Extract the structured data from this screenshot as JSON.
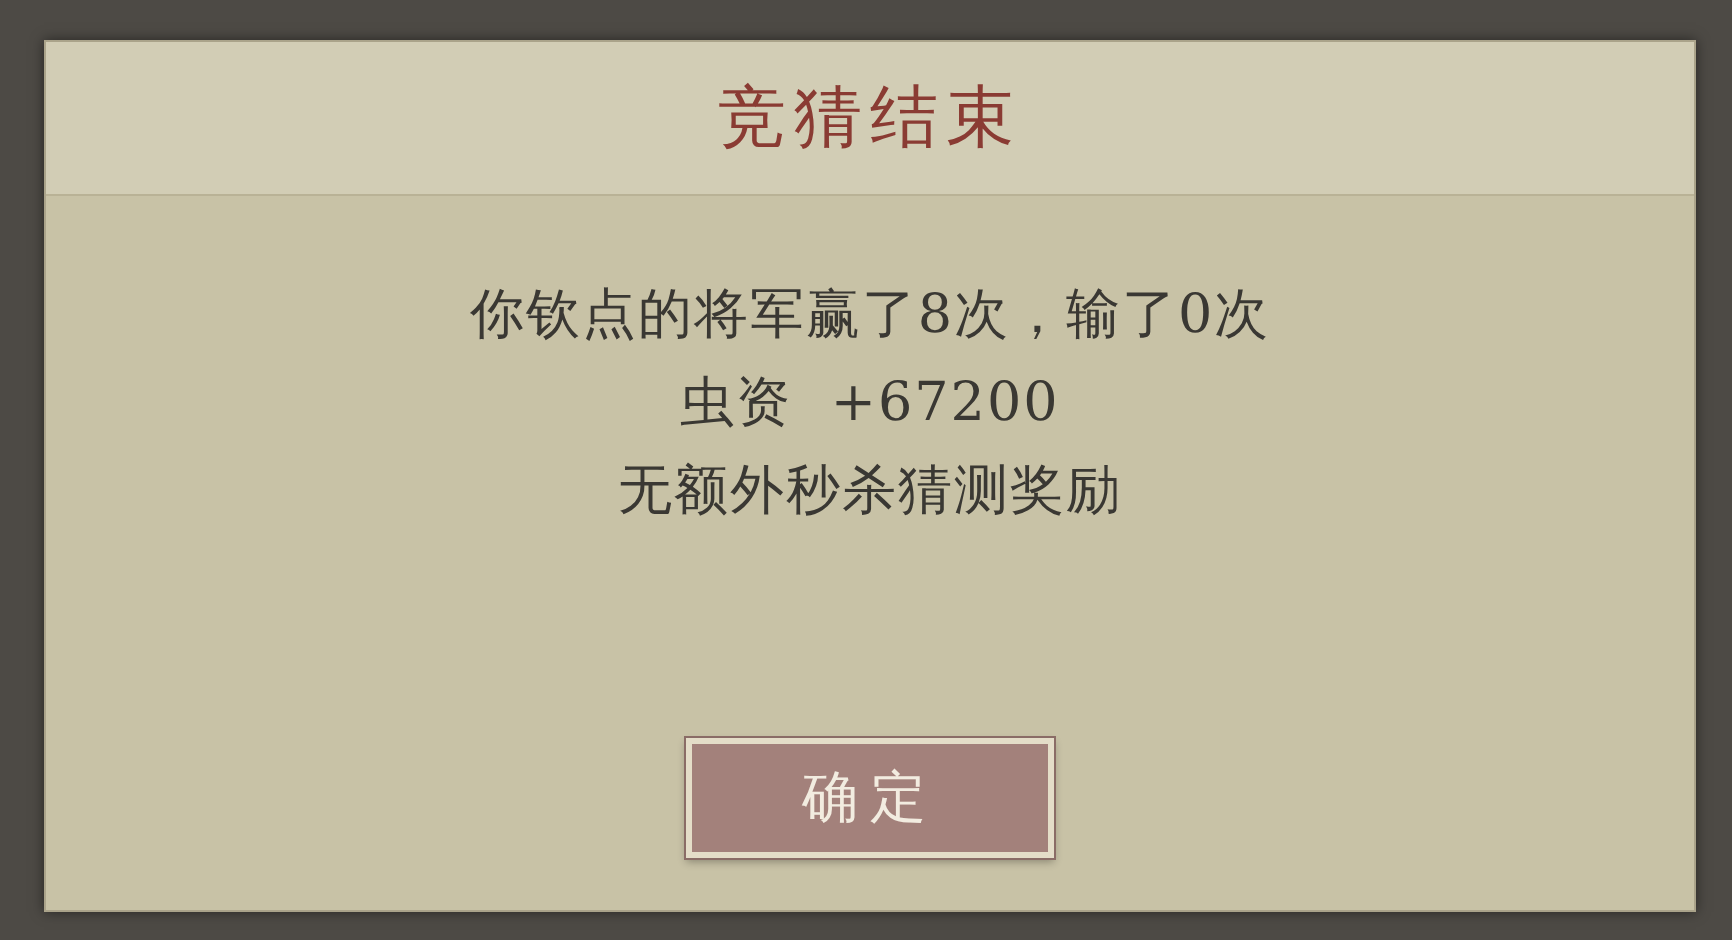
{
  "dialog": {
    "title": "竞猜结束",
    "lines": [
      "你钦点的将军赢了8次，输了0次",
      "虫资  +67200",
      "无额外秒杀猜测奖励"
    ],
    "button": "确定"
  }
}
